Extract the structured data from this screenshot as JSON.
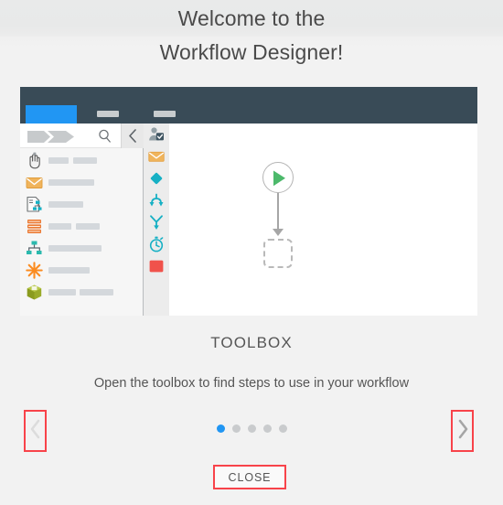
{
  "header": {
    "title_line1": "Welcome to the",
    "title_line2": "Workflow Designer!"
  },
  "screenshot": {
    "topbar_color": "#394b57",
    "tabs": [
      {
        "name": "tab-active",
        "active": true,
        "color": "#2196f3"
      },
      {
        "name": "tab-second",
        "active": false
      },
      {
        "name": "tab-third",
        "active": false
      }
    ],
    "toolbox_panel": {
      "search_placeholder": "",
      "breadcrumb_icon": "breadcrumb-chevrons-icon",
      "search_icon": "search-icon",
      "collapse_icon": "chevron-left-icon",
      "items": [
        {
          "icon": "hand-cursor-icon",
          "bars": [
            22,
            26
          ]
        },
        {
          "icon": "envelope-icon",
          "bars": [
            50
          ]
        },
        {
          "icon": "document-flow-icon",
          "bars": [
            38
          ]
        },
        {
          "icon": "database-icon",
          "bars": [
            25,
            26
          ]
        },
        {
          "icon": "org-chart-icon",
          "bars": [
            58
          ]
        },
        {
          "icon": "asterisk-icon",
          "bars": [
            45
          ]
        },
        {
          "icon": "package-cube-icon",
          "bars": [
            30,
            37
          ]
        }
      ]
    },
    "rail": {
      "items": [
        {
          "icon": "user-approve-icon",
          "color": "#7f8c8d"
        },
        {
          "icon": "envelope-icon",
          "color": "#f0ad4e"
        },
        {
          "icon": "decision-diamond-icon",
          "color": "#16b0c4"
        },
        {
          "icon": "branch-merge-icon",
          "color": "#16b0c4"
        },
        {
          "icon": "fork-icon",
          "color": "#16b0c4"
        },
        {
          "icon": "timer-icon",
          "color": "#16b0c4"
        },
        {
          "icon": "stop-square-icon",
          "color": "#f0524b"
        }
      ]
    },
    "canvas": {
      "start_node_icon": "play-triangle-icon",
      "start_node_color": "#4cb96b",
      "ghost_node_label": "",
      "connector_color": "#a6a6a6"
    }
  },
  "caption": {
    "title": "TOOLBOX",
    "body": "Open the toolbox to find steps to use in your workflow"
  },
  "nav": {
    "prev_icon": "chevron-left-icon",
    "next_icon": "chevron-right-icon",
    "prev_enabled": false,
    "next_enabled": true,
    "highlight_color": "#f8434a"
  },
  "pagination": {
    "total": 5,
    "current": 1
  },
  "footer": {
    "close_label": "CLOSE"
  }
}
